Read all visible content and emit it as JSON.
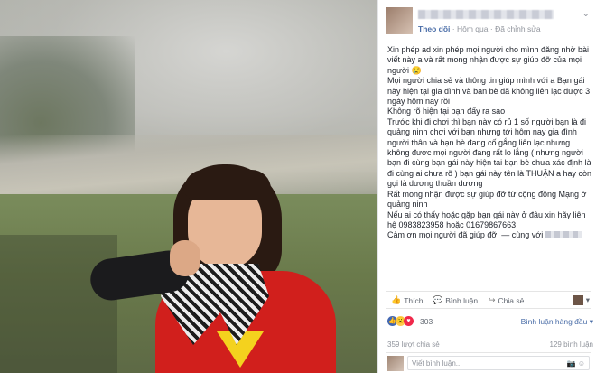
{
  "post": {
    "follow": "Theo dõi",
    "time": "Hôm qua",
    "edited": "Đã chỉnh sửa",
    "paragraphs": [
      "Xin phép ad xin phép mọi người cho mình đăng nhờ bài viết này a và rất mong nhận được sự giúp đỡ của mọi người 😢",
      "Mọi người chia sẻ và thông tin giúp mình với a Bạn gái này hiện tại gia đình và bạn bè đã không liên lạc được 3 ngày hôm nay rồi",
      "Không rõ hiện tại bạn đấy ra sao",
      "Trước khi đi chơi thì bạn này có rủ 1 số người bạn là đi quảng ninh chơi với bạn nhưng tới hôm nay gia đình người thân và bạn bè đang cố gắng liên lạc nhưng không được mọi người đang rất lo lắng ( nhưng người bạn đi cùng bạn gái này hiện tại bạn bè chưa xác định là đi cùng ai chưa rõ ) bạn gái này tên là THUẬN a hay còn gọi là dương thuần dương",
      "Rất mong nhận được sự giúp đỡ từ cộng đồng Mạng ở quảng ninh",
      "Nếu ai có thấy hoặc gặp bạn gái này ở đâu xin hãy liên hệ 0983823958 hoặc 01679867663"
    ],
    "thanks": "Cảm ơn mọi người đã giúp đỡ! — cùng với"
  },
  "actions": {
    "like": "Thích",
    "comment": "Bình luận",
    "share": "Chia sẻ"
  },
  "reactions": {
    "count": "303",
    "sort": "Bình luận hàng đầu ▾"
  },
  "counts": {
    "shares": "359 lượt chia sẻ",
    "comments": "129 bình luận"
  },
  "comment_box": {
    "placeholder": "Viết bình luận..."
  },
  "icons": [
    "like-icon",
    "comment-icon",
    "share-icon",
    "camera-icon",
    "emoji-icon"
  ]
}
